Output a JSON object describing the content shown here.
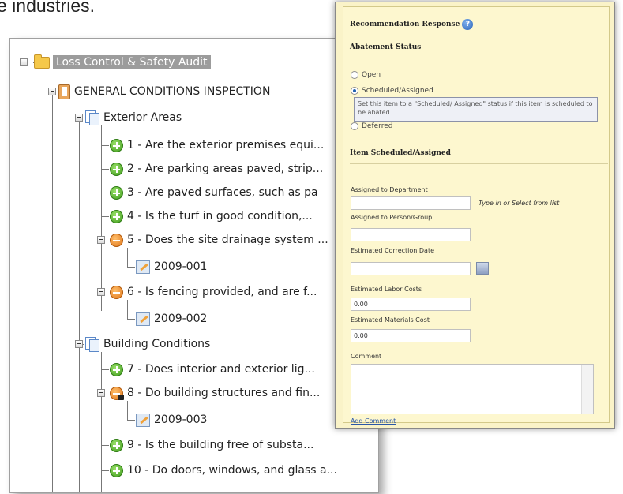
{
  "background": {
    "heading_fragment": "e industries."
  },
  "tree": {
    "root_label": "Loss Control & Safety Audit",
    "inspection_label": "GENERAL CONDITIONS INSPECTION",
    "groups": [
      {
        "label": "Exterior Areas",
        "items": [
          {
            "status": "ok",
            "label": "1 - Are the exterior premises equi..."
          },
          {
            "status": "ok",
            "label": "2 - Are parking areas paved, strip..."
          },
          {
            "status": "ok",
            "label": "3 - Are paved surfaces, such as pa"
          },
          {
            "status": "ok",
            "label": "4 - Is the turf in good condition,..."
          },
          {
            "status": "warn",
            "label": "5 - Does the site drainage system ...",
            "recommendation": "2009-001"
          },
          {
            "status": "warn",
            "label": "6 - Is fencing provided, and are f...",
            "recommendation": "2009-002"
          }
        ]
      },
      {
        "label": "Building Conditions",
        "items": [
          {
            "status": "ok",
            "label": "7 - Does interior and exterior lig..."
          },
          {
            "status": "warn",
            "label": "8 - Do building structures and fin...",
            "recommendation": "2009-003",
            "locked": true
          },
          {
            "status": "ok",
            "label": "9 - Is the building free of substa..."
          },
          {
            "status": "ok",
            "label": "10 - Do doors, windows, and glass a..."
          }
        ]
      }
    ]
  },
  "popup": {
    "title": "Recommendation Response",
    "abatement_heading": "Abatement Status",
    "status_options": [
      "Open",
      "Scheduled/Assigned",
      "Deferred"
    ],
    "selected_status": "Scheduled/Assigned",
    "tooltip": "Set this item to a \"Scheduled/ Assigned\" status if this item is scheduled to be abated.",
    "scheduled_heading": "Item Scheduled/Assigned",
    "fields": {
      "department_label": "Assigned to Department",
      "department_value": "",
      "department_hint": "Type in or Select from list",
      "person_label": "Assigned to Person/Group",
      "person_value": "",
      "date_label": "Estimated Correction Date",
      "date_value": "",
      "labor_label": "Estimated Labor Costs",
      "labor_value": "0.00",
      "materials_label": "Estimated Materials Cost",
      "materials_value": "0.00",
      "comment_label": "Comment",
      "comment_value": ""
    },
    "add_comment_link": "Add Comment"
  }
}
